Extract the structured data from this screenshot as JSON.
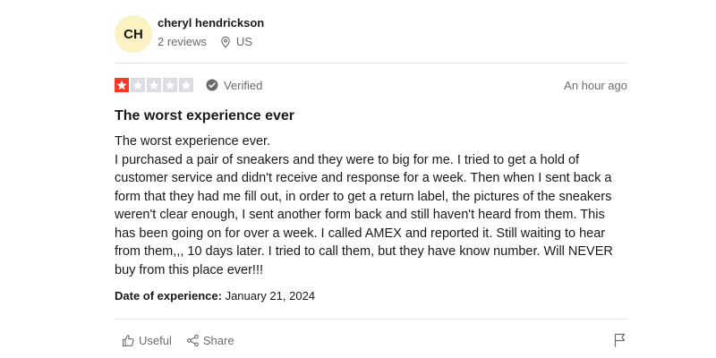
{
  "reviewer": {
    "initials": "CH",
    "name": "cheryl hendrickson",
    "reviews_count": "2 reviews",
    "country": "US",
    "avatar_bg": "#fbf2c4",
    "location_icon": "location-pin-icon"
  },
  "rating": {
    "stars": 1,
    "max_stars": 5,
    "star_on_color": "#ff3722",
    "star_off_color": "#dcdce6",
    "verified_label": "Verified",
    "verified_icon": "check-circle-icon",
    "time_ago": "An hour ago"
  },
  "review": {
    "title": "The worst experience ever",
    "body_line1": "The worst experience ever.",
    "body_line2": "I purchased a pair of sneakers and they were to big for me. I tried to get a hold of customer service and didn't receive and response for a week. Then when I sent back a form that they had me fill out, in order to get a return label, the pictures of the sneakers weren't clear enough, I sent another form back and still haven't heard from them. This has been going on for over a week. I called AMEX and reported it. Still waiting to hear from them,,, 10 days later. I tried to call them, but they have know number. Will NEVER buy from this place ever!!!",
    "experience_label": "Date of experience:",
    "experience_date": "January 21, 2024"
  },
  "actions": {
    "useful_label": "Useful",
    "useful_icon": "thumbs-up-icon",
    "share_label": "Share",
    "share_icon": "share-icon",
    "flag_icon": "flag-icon"
  }
}
